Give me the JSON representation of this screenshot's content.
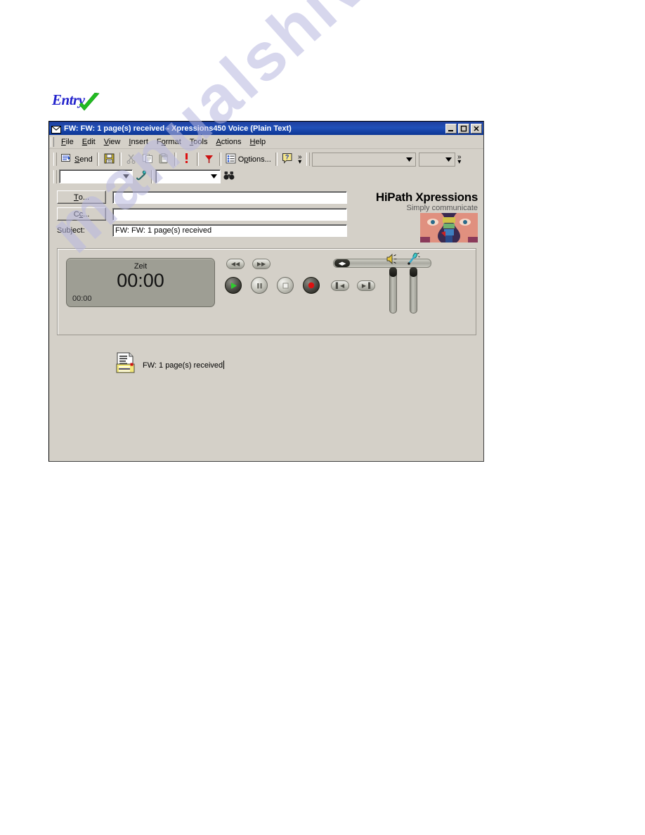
{
  "page": {
    "watermark": "manualshive.com"
  },
  "logo": {
    "text": "Entry",
    "check_icon": "green-check-icon"
  },
  "window": {
    "title": "FW: FW: 1 page(s) received - Xpressions450 Voice (Plain Text)",
    "title_icon": "envelope-icon",
    "controls": {
      "minimize": "_",
      "maximize": "□",
      "close": "✕"
    }
  },
  "menu": {
    "items": [
      {
        "label": "File",
        "accel": "F"
      },
      {
        "label": "Edit",
        "accel": "E"
      },
      {
        "label": "View",
        "accel": "V"
      },
      {
        "label": "Insert",
        "accel": "I"
      },
      {
        "label": "Format",
        "accel": "o"
      },
      {
        "label": "Tools",
        "accel": "T"
      },
      {
        "label": "Actions",
        "accel": "A"
      },
      {
        "label": "Help",
        "accel": "H"
      }
    ]
  },
  "toolbar": {
    "send_label": "Send",
    "send_icon": "send-envelope-icon",
    "save_icon": "floppy-save-icon",
    "cut_icon": "scissors-icon",
    "copy_icon": "copy-icon",
    "paste_icon": "paste-clipboard-icon",
    "importance_icon": "red-exclamation-icon",
    "flag_icon": "red-flag-icon",
    "options_label": "Options...",
    "options_icon": "options-list-icon",
    "help_icon": "question-mark-icon",
    "overflow_icon": "double-chevron-icon",
    "overflow_label": "»",
    "combo1_value": "",
    "combo2_value": ""
  },
  "toolbar2": {
    "combo1_value": "",
    "phone_icon": "phone-handset-icon",
    "combo2_value": "",
    "find_icon": "binoculars-icon"
  },
  "header": {
    "to_label": "To...",
    "to_accel": "T",
    "to_value": "",
    "cc_label": "Cc...",
    "cc_accel": "c",
    "cc_value": "",
    "subject_label": "Subject:",
    "subject_value": "FW: FW: 1 page(s) received"
  },
  "brand": {
    "title": "HiPath Xpressions",
    "subtitle": "Simply communicate",
    "image_name": "hipath-faces-graphic"
  },
  "player": {
    "display": {
      "caption": "Zeit",
      "time": "00:00",
      "position": "00:00"
    },
    "buttons": {
      "rewind": "rewind-icon",
      "fast_forward": "fast-forward-icon",
      "play": "play-icon",
      "pause": "pause-icon",
      "stop": "stop-icon",
      "record": "record-icon",
      "go_start": "skip-to-start-icon",
      "go_end": "skip-to-end-icon"
    },
    "seek": {
      "name": "seek-slider",
      "value": 0
    },
    "volume": {
      "speaker_icon": "speaker-icon",
      "speaker_value": 0,
      "mic_icon": "microphone-icon",
      "mic_value": 0
    }
  },
  "body": {
    "attachment_icon": "fax-document-attachment-icon",
    "attachment_label": "FW: 1 page(s) received"
  },
  "colors": {
    "titlebar": "#1e3f9e",
    "face": "#d4d0c8",
    "lcd": "#9e9e94",
    "accent_red": "#cc0000",
    "accent_green": "#00a000",
    "logo_blue": "#2222cc",
    "watermark": "#b8b8e0"
  }
}
